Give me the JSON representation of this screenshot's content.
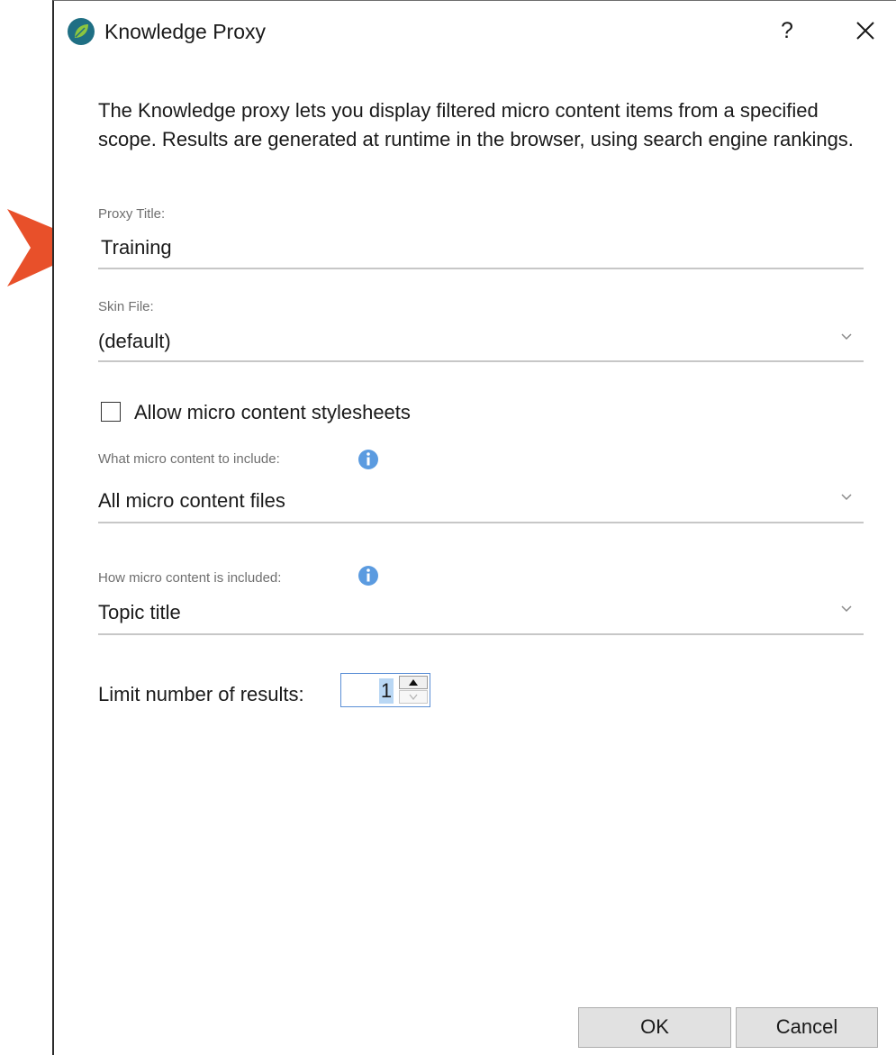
{
  "window": {
    "title": "Knowledge Proxy",
    "help_label": "?",
    "close_icon": "close-icon",
    "app_icon": "leaf-logo-icon"
  },
  "description": "The Knowledge proxy lets you display filtered micro content items from a specified scope. Results are generated at runtime in the browser, using search engine rankings.",
  "fields": {
    "proxy_title": {
      "label": "Proxy Title:",
      "value": "Training"
    },
    "skin_file": {
      "label": "Skin File:",
      "value": "(default)"
    },
    "allow_stylesheets": {
      "label": "Allow micro content stylesheets",
      "checked": false
    },
    "what_include": {
      "label": "What micro content to include:",
      "value": "All micro content files",
      "info_icon": "info-icon"
    },
    "how_include": {
      "label": "How micro content is included:",
      "value": "Topic title",
      "info_icon": "info-icon"
    },
    "limit_results": {
      "label": "Limit number of results:",
      "value": "1"
    }
  },
  "buttons": {
    "ok": "OK",
    "cancel": "Cancel"
  },
  "colors": {
    "callout_arrow": "#e8502a",
    "info_icon": "#5b9be0",
    "app_icon_bg": "#1f6f84",
    "app_icon_leaf": "#8cc63f",
    "focus_border": "#5b8fd6",
    "selection": "#b9d7f4"
  }
}
